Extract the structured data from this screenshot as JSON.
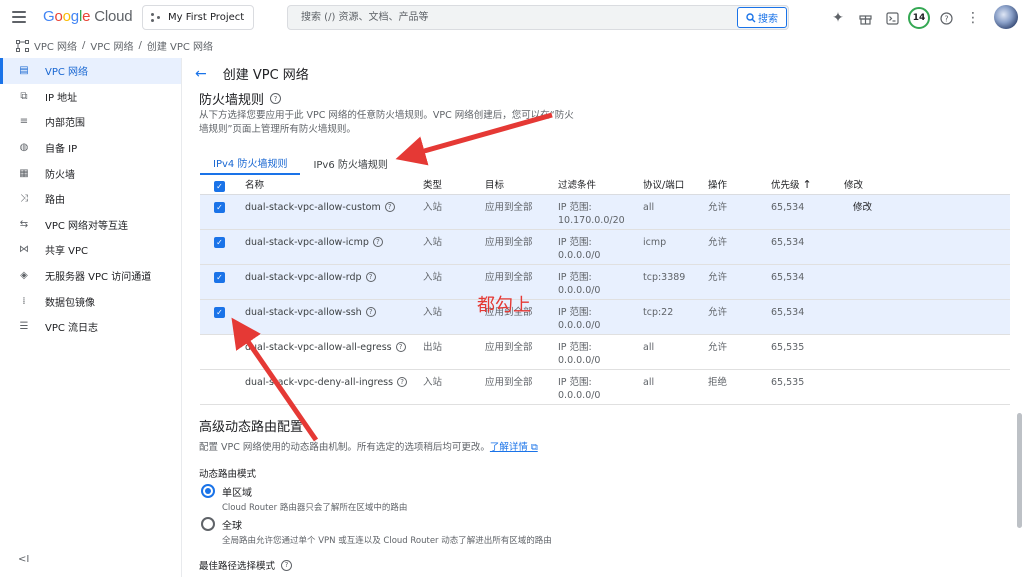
{
  "topbar": {
    "logo_google": [
      "G",
      "o",
      "o",
      "g",
      "l",
      "e"
    ],
    "logo_cloud": "Cloud",
    "project": "My First Project",
    "search_placeholder": "搜索 (/) 资源、文档、产品等",
    "search_button": "搜索",
    "notification_count": "14"
  },
  "breadcrumb": [
    "VPC 网络",
    "VPC 网络",
    "创建 VPC 网络"
  ],
  "sidebar": {
    "items": [
      {
        "label": "VPC 网络",
        "icon": "vpc-icon",
        "active": true
      },
      {
        "label": "IP 地址",
        "icon": "ip-icon"
      },
      {
        "label": "内部范围",
        "icon": "range-icon"
      },
      {
        "label": "自备 IP",
        "icon": "globe-icon"
      },
      {
        "label": "防火墙",
        "icon": "firewall-icon"
      },
      {
        "label": "路由",
        "icon": "route-icon"
      },
      {
        "label": "VPC 网络对等互连",
        "icon": "peering-icon"
      },
      {
        "label": "共享 VPC",
        "icon": "shared-vpc-icon"
      },
      {
        "label": "无服务器 VPC 访问通道",
        "icon": "serverless-icon"
      },
      {
        "label": "数据包镜像",
        "icon": "mirror-icon"
      },
      {
        "label": "VPC 流日志",
        "icon": "logs-icon"
      }
    ],
    "collapse": "<I"
  },
  "page": {
    "title": "创建 VPC 网络",
    "firewall_title": "防火墙规则",
    "firewall_desc": "从下方选择您要应用于此 VPC 网络的任意防火墙规则。VPC 网络创建后，您可以在“防火墙规则”页面上管理所有防火墙规则。",
    "tabs": [
      "IPv4 防火墙规则",
      "IPv6 防火墙规则"
    ],
    "columns": [
      "名称",
      "类型",
      "目标",
      "过滤条件",
      "协议/端口",
      "操作",
      "优先级",
      "修改"
    ],
    "rules": [
      {
        "name": "dual-stack-vpc-allow-custom",
        "type": "入站",
        "target": "应用到全部",
        "filter1": "IP 范围:",
        "filter2": "10.170.0.0/20",
        "proto": "all",
        "action": "允许",
        "priority": "65,534",
        "edit": "修改",
        "checked": true
      },
      {
        "name": "dual-stack-vpc-allow-icmp",
        "type": "入站",
        "target": "应用到全部",
        "filter1": "IP 范围:",
        "filter2": "0.0.0.0/0",
        "proto": "icmp",
        "action": "允许",
        "priority": "65,534",
        "edit": "",
        "checked": true
      },
      {
        "name": "dual-stack-vpc-allow-rdp",
        "type": "入站",
        "target": "应用到全部",
        "filter1": "IP 范围:",
        "filter2": "0.0.0.0/0",
        "proto": "tcp:3389",
        "action": "允许",
        "priority": "65,534",
        "edit": "",
        "checked": true
      },
      {
        "name": "dual-stack-vpc-allow-ssh",
        "type": "入站",
        "target": "应用到全部",
        "filter1": "IP 范围:",
        "filter2": "0.0.0.0/0",
        "proto": "tcp:22",
        "action": "允许",
        "priority": "65,534",
        "edit": "",
        "checked": true
      },
      {
        "name": "dual-stack-vpc-allow-all-egress",
        "type": "出站",
        "target": "应用到全部",
        "filter1": "IP 范围:",
        "filter2": "0.0.0.0/0",
        "proto": "all",
        "action": "允许",
        "priority": "65,535",
        "edit": "",
        "checked": false
      },
      {
        "name": "dual-stack-vpc-deny-all-ingress",
        "type": "入站",
        "target": "应用到全部",
        "filter1": "IP 范围:",
        "filter2": "0.0.0.0/0",
        "proto": "all",
        "action": "拒绝",
        "priority": "65,535",
        "edit": "",
        "checked": false
      }
    ],
    "annotation": "都勾上",
    "adv_title": "高级动态路由配置",
    "adv_desc": "配置 VPC 网络使用的动态路由机制。所有选定的选项稍后均可更改。",
    "adv_link": "了解详情",
    "mode_label": "动态路由模式",
    "modes": [
      {
        "label": "单区域",
        "sub": "Cloud Router 路由器只会了解所在区域中的路由",
        "selected": true
      },
      {
        "label": "全球",
        "sub": "全局路由允许您通过单个 VPN 或互连以及 Cloud Router 动态了解进出所有区域的路由",
        "selected": false
      }
    ],
    "best_path": "最佳路径选择模式"
  },
  "colors": {
    "accent": "#1a73e8",
    "annotation": "#e53935",
    "selected_row": "#e8f0fe"
  }
}
